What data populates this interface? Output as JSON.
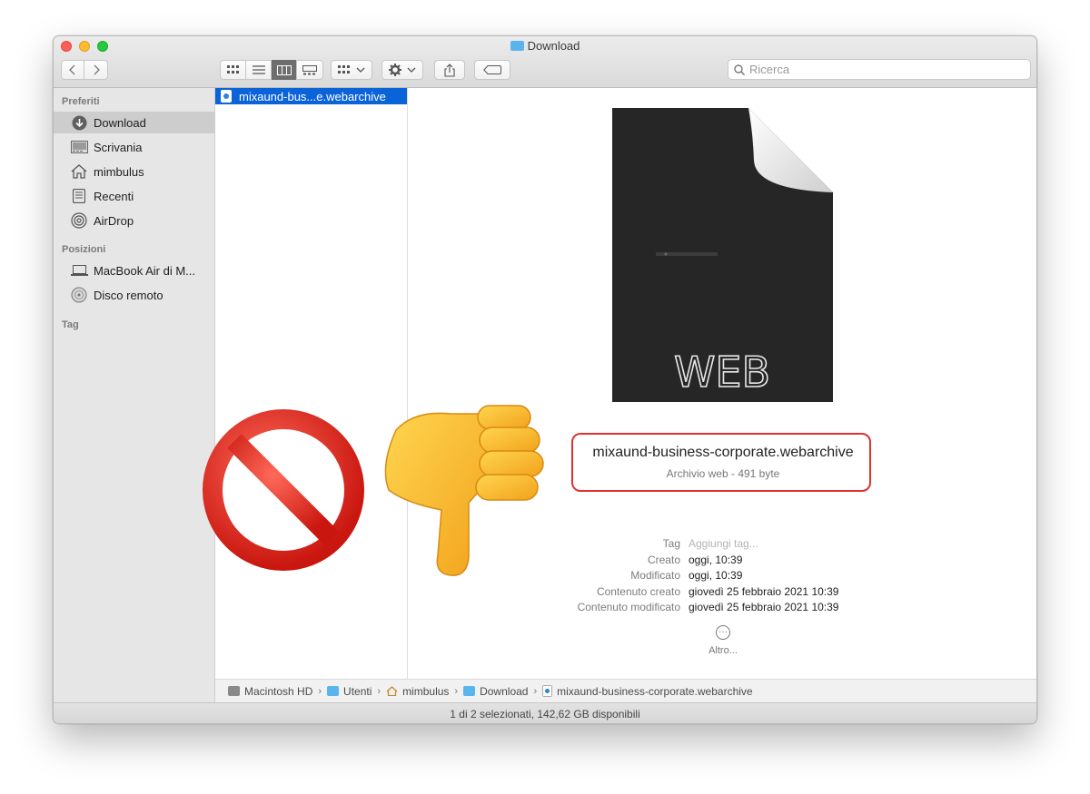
{
  "window": {
    "title": "Download"
  },
  "toolbar": {
    "back_label": "<",
    "forward_label": ">",
    "search_placeholder": "Ricerca"
  },
  "sidebar": {
    "favorites_header": "Preferiti",
    "favorites": [
      {
        "label": "Download",
        "icon": "download-icon",
        "selected": true
      },
      {
        "label": "Scrivania",
        "icon": "desktop-icon"
      },
      {
        "label": "mimbulus",
        "icon": "home-icon"
      },
      {
        "label": "Recenti",
        "icon": "recents-icon"
      },
      {
        "label": "AirDrop",
        "icon": "airdrop-icon"
      }
    ],
    "locations_header": "Posizioni",
    "locations": [
      {
        "label": "MacBook Air di M...",
        "icon": "laptop-icon"
      },
      {
        "label": "Disco remoto",
        "icon": "disc-icon"
      }
    ],
    "tags_header": "Tag"
  },
  "column": {
    "selected_file": "mixaund-bus...e.webarchive"
  },
  "preview": {
    "doc_badge": "WEB",
    "file_name": "mixaund-business-corporate.webarchive",
    "file_kind": "Archivio web - 491 byte",
    "info": [
      {
        "label": "Tag",
        "value": "Aggiungi tag...",
        "placeholder": true
      },
      {
        "label": "Creato",
        "value": "oggi, 10:39"
      },
      {
        "label": "Modificato",
        "value": "oggi, 10:39"
      },
      {
        "label": "Contenuto creato",
        "value": "giovedì 25 febbraio 2021 10:39"
      },
      {
        "label": "Contenuto modificato",
        "value": "giovedì 25 febbraio 2021 10:39"
      }
    ],
    "more_label": "Altro..."
  },
  "pathbar": {
    "crumbs": [
      "Macintosh HD",
      "Utenti",
      "mimbulus",
      "Download",
      "mixaund-business-corporate.webarchive"
    ]
  },
  "statusbar": {
    "text": "1 di 2 selezionati, 142,62 GB disponibili"
  },
  "colors": {
    "selection_blue": "#0b63d9",
    "highlight_red": "#e0312d",
    "folder_blue": "#5ab5ec"
  },
  "overlays": [
    "prohibited-sign-icon",
    "thumbs-down-icon"
  ]
}
